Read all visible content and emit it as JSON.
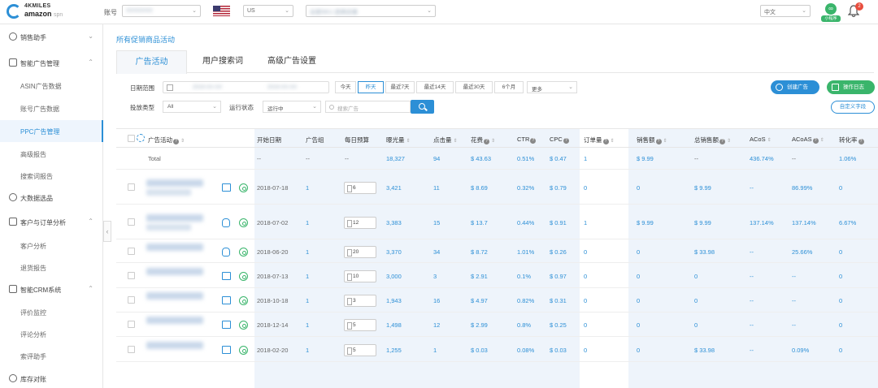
{
  "brand": {
    "line1": "4KMILES",
    "line2": "amazon",
    "line2_suffix": "spn"
  },
  "topbar": {
    "account_label": "账号",
    "account_value": "XXXXXXX",
    "marketplace_value": "US",
    "store_value": "全部SKU 选择店铺",
    "language_value": "中文",
    "mini_program_label": "小程序",
    "notification_count": "2"
  },
  "sidebar": {
    "groups": [
      {
        "label": "销售助手",
        "icon": "dashboard-icon"
      },
      {
        "label": "智能广告管理",
        "icon": "ad-icon",
        "children": [
          "ASIN广告数据",
          "账号广告数据",
          "PPC广告管理",
          "高级报告",
          "搜索词报告"
        ]
      },
      {
        "label": "大数据选品",
        "icon": "bigdata-icon"
      },
      {
        "label": "客户与订单分析",
        "icon": "customer-icon",
        "children": [
          "客户分析",
          "退货报告"
        ]
      },
      {
        "label": "智能CRM系统",
        "icon": "crm-icon",
        "children": [
          "评价监控",
          "评论分析",
          "索评助手"
        ]
      },
      {
        "label": "库存对账",
        "icon": "inventory-icon"
      }
    ],
    "active_item": "PPC广告管理"
  },
  "breadcrumb": "所有促销商品活动",
  "tabs": [
    "广告活动",
    "用户搜索词",
    "高级广告设置"
  ],
  "filters": {
    "date_label": "日期范围",
    "date_start": "2019-XX-XX",
    "date_end": "2019-XX-XX",
    "ranges": [
      "今天",
      "昨天",
      "最近7天",
      "最近14天",
      "最近30天",
      "6个月"
    ],
    "active_range": "昨天",
    "more_label": "更多",
    "type_label": "投放类型",
    "type_value": "All",
    "status_label": "运行状态",
    "status_value": "运行中",
    "search_placeholder": "搜索广告",
    "create_button": "创建广告",
    "log_button": "操作日志",
    "custom_button": "自定义字段"
  },
  "table": {
    "headers": [
      "广告活动",
      "开始日期",
      "广告组",
      "每日预算",
      "曝光量",
      "点击量",
      "花费",
      "CTR",
      "CPC",
      "订单量",
      "销售额",
      "总销售额",
      "ACoS",
      "ACoAS",
      "转化率"
    ],
    "total": {
      "label": "Total",
      "start": "--",
      "group": "--",
      "budget": "--",
      "impressions": "18,327",
      "clicks": "94",
      "spend": "$ 43.63",
      "ctr": "0.51%",
      "cpc": "$ 0.47",
      "orders": "1",
      "sales": "$ 9.99",
      "total_sales": "--",
      "acos": "436.74%",
      "acoas": "--",
      "cvr": "1.06%"
    },
    "rows": [
      {
        "start": "2018-07-18",
        "group": "1",
        "budget": "6",
        "impressions": "3,421",
        "clicks": "11",
        "spend": "$ 8.69",
        "ctr": "0.32%",
        "cpc": "$ 0.79",
        "orders": "0",
        "sales": "0",
        "total_sales": "$ 9.99",
        "acos": "--",
        "acoas": "86.99%",
        "cvr": "0",
        "icon": "monitor-icon"
      },
      {
        "start": "2018-07-02",
        "group": "1",
        "budget": "12",
        "impressions": "3,383",
        "clicks": "15",
        "spend": "$ 13.7",
        "ctr": "0.44%",
        "cpc": "$ 0.91",
        "orders": "1",
        "sales": "$ 9.99",
        "total_sales": "$ 9.99",
        "acos": "137.14%",
        "acoas": "137.14%",
        "cvr": "6.67%",
        "icon": "hand-icon"
      },
      {
        "start": "2018-06-20",
        "group": "1",
        "budget": "20",
        "impressions": "3,370",
        "clicks": "34",
        "spend": "$ 8.72",
        "ctr": "1.01%",
        "cpc": "$ 0.26",
        "orders": "0",
        "sales": "0",
        "total_sales": "$ 33.98",
        "acos": "--",
        "acoas": "25.66%",
        "cvr": "0",
        "icon": "hand-icon"
      },
      {
        "start": "2018-07-13",
        "group": "1",
        "budget": "10",
        "impressions": "3,000",
        "clicks": "3",
        "spend": "$ 2.91",
        "ctr": "0.1%",
        "cpc": "$ 0.97",
        "orders": "0",
        "sales": "0",
        "total_sales": "0",
        "acos": "--",
        "acoas": "--",
        "cvr": "0",
        "icon": "monitor-icon"
      },
      {
        "start": "2018-10-18",
        "group": "1",
        "budget": "3",
        "impressions": "1,943",
        "clicks": "16",
        "spend": "$ 4.97",
        "ctr": "0.82%",
        "cpc": "$ 0.31",
        "orders": "0",
        "sales": "0",
        "total_sales": "0",
        "acos": "--",
        "acoas": "--",
        "cvr": "0",
        "icon": "monitor-icon"
      },
      {
        "start": "2018-12-14",
        "group": "1",
        "budget": "5",
        "impressions": "1,498",
        "clicks": "12",
        "spend": "$ 2.99",
        "ctr": "0.8%",
        "cpc": "$ 0.25",
        "orders": "0",
        "sales": "0",
        "total_sales": "0",
        "acos": "--",
        "acoas": "--",
        "cvr": "0",
        "icon": "monitor-icon"
      },
      {
        "start": "2018-02-20",
        "group": "1",
        "budget": "5",
        "impressions": "1,255",
        "clicks": "1",
        "spend": "$ 0.03",
        "ctr": "0.08%",
        "cpc": "$ 0.03",
        "orders": "0",
        "sales": "0",
        "total_sales": "$ 33.98",
        "acos": "--",
        "acoas": "0.09%",
        "cvr": "0",
        "icon": "monitor-icon"
      }
    ]
  },
  "colors": {
    "accent": "#2c8fd6",
    "green": "#3ab56b",
    "highlight_col": "#eef4fb",
    "badge": "#e84d3d"
  }
}
